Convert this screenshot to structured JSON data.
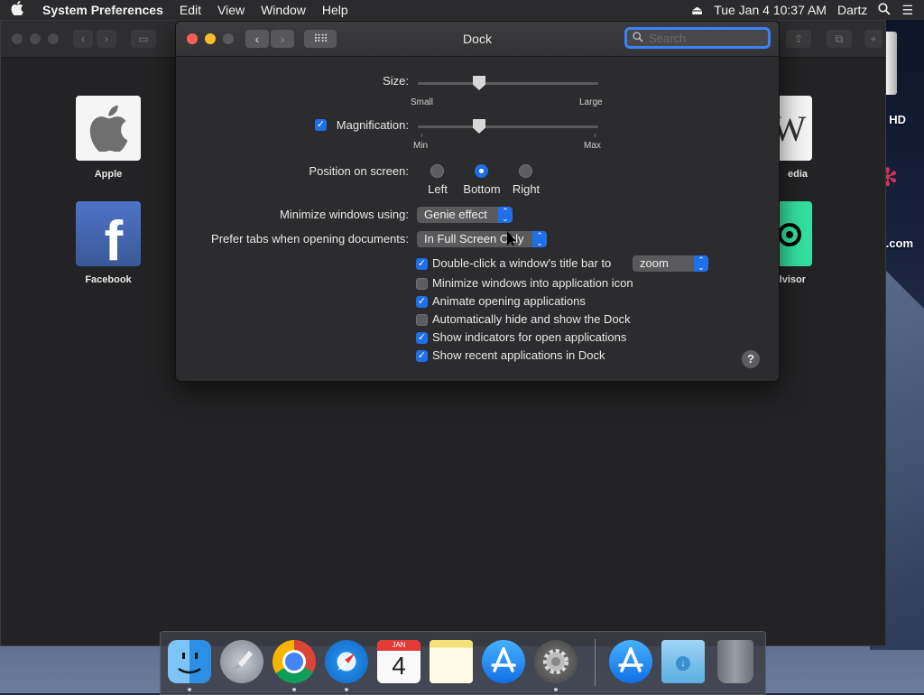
{
  "menubar": {
    "apple_icon": "apple-logo-icon",
    "app_name": "System Preferences",
    "items": [
      "Edit",
      "View",
      "Window",
      "Help"
    ],
    "clock": "Tue Jan 4  10:37 AM",
    "user": "Dartz"
  },
  "desktop": {
    "hd_label": "HD",
    "com_label": ".com"
  },
  "background_window": {
    "tiles": [
      {
        "label": "Apple"
      },
      {
        "label": "Facebook"
      },
      {
        "label": "edia"
      },
      {
        "label": "dvisor"
      }
    ]
  },
  "window": {
    "title": "Dock",
    "search_placeholder": "Search"
  },
  "size": {
    "label": "Size:",
    "min_label": "Small",
    "max_label": "Large",
    "value": 0.34
  },
  "magnification": {
    "label": "Magnification:",
    "checked": true,
    "min_label": "Min",
    "max_label": "Max",
    "value": 0.34
  },
  "position": {
    "label": "Position on screen:",
    "options": [
      "Left",
      "Bottom",
      "Right"
    ],
    "selected": "Bottom"
  },
  "minimize": {
    "label": "Minimize windows using:",
    "value": "Genie effect"
  },
  "prefer_tabs": {
    "label": "Prefer tabs when opening documents:",
    "value": "In Full Screen Only"
  },
  "double_click": {
    "label": "Double-click a window's title bar to",
    "checked": true,
    "value": "zoom"
  },
  "checkboxes": [
    {
      "label": "Minimize windows into application icon",
      "checked": false
    },
    {
      "label": "Animate opening applications",
      "checked": true
    },
    {
      "label": "Automatically hide and show the Dock",
      "checked": false
    },
    {
      "label": "Show indicators for open applications",
      "checked": true
    },
    {
      "label": "Show recent applications in Dock",
      "checked": true
    }
  ],
  "help_label": "?",
  "dock": {
    "calendar_month": "JAN",
    "calendar_day": "4",
    "apps": [
      {
        "name": "finder-icon",
        "running": true
      },
      {
        "name": "launchpad-icon",
        "running": false
      },
      {
        "name": "chrome-icon",
        "running": true
      },
      {
        "name": "safari-icon",
        "running": true
      },
      {
        "name": "calendar-icon",
        "running": false
      },
      {
        "name": "notes-icon",
        "running": false
      },
      {
        "name": "app-store-icon",
        "running": false
      },
      {
        "name": "system-preferences-icon",
        "running": true
      },
      {
        "name": "app-store-recent-icon",
        "running": false
      },
      {
        "name": "downloads-folder-icon",
        "running": false
      },
      {
        "name": "trash-icon",
        "running": false
      }
    ]
  },
  "colors": {
    "accent": "#1f6fe8",
    "close": "#fc5f57",
    "minimize": "#fdbc2e",
    "zoom_disabled": "#5a5a5c"
  }
}
